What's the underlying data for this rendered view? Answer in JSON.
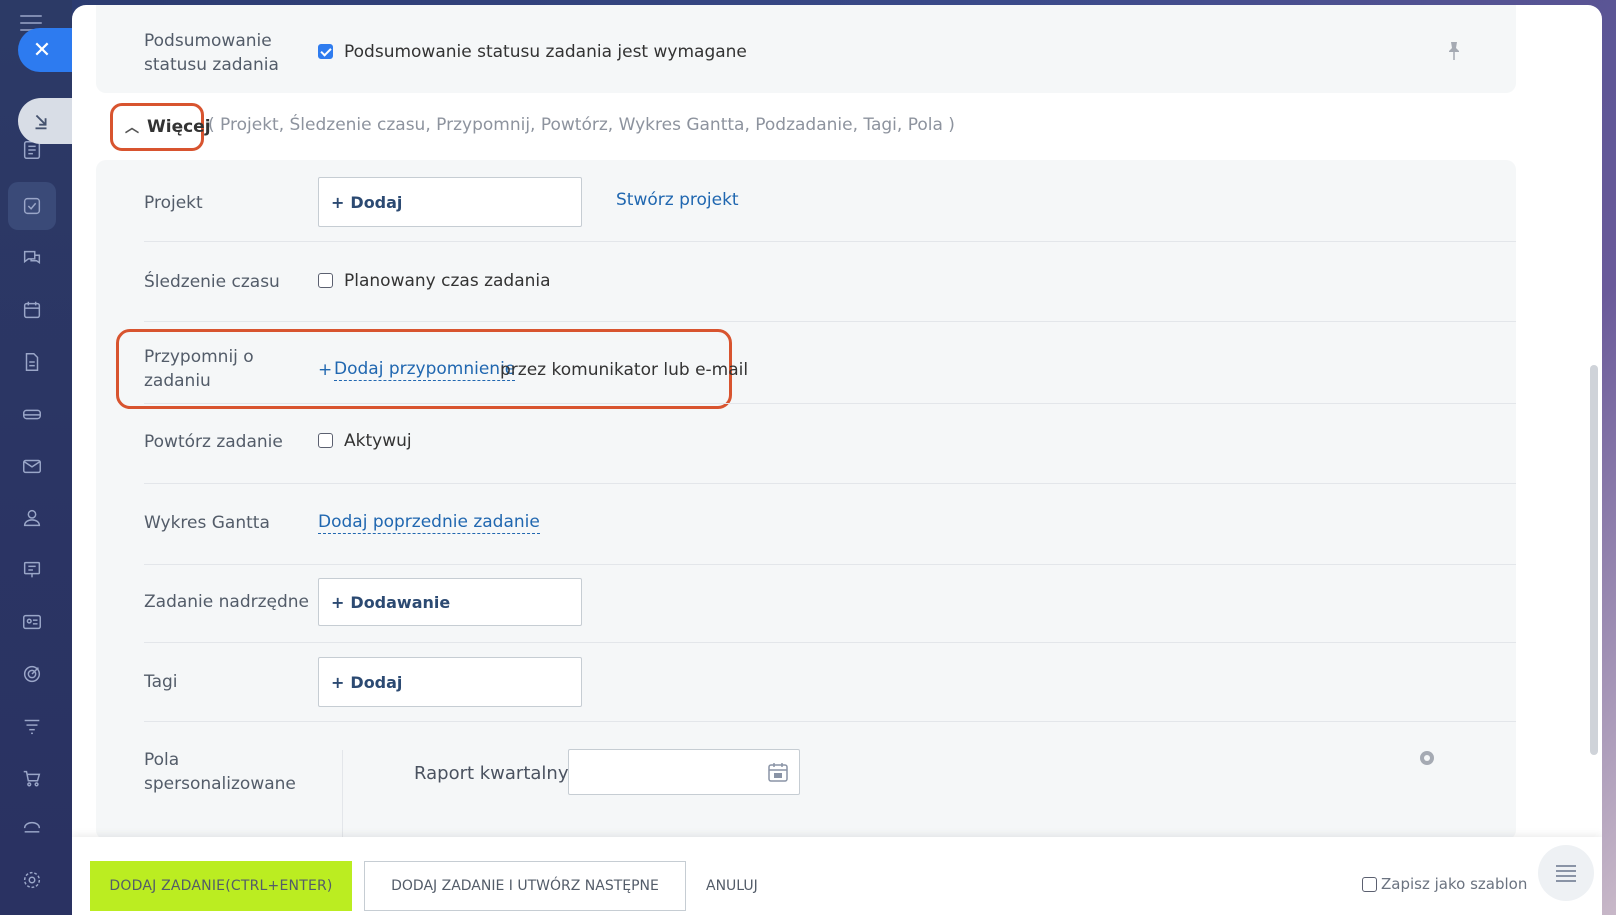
{
  "summary": {
    "label": "Podsumowanie statusu zadania",
    "checkbox_text": "Podsumowanie statusu zadania jest wymagane"
  },
  "more": {
    "button_label": "Więcej",
    "list_text": "( Projekt,  Śledzenie czasu,  Przypomnij,  Powtórz,  Wykres Gantta,  Podzadanie,  Tagi,  Pola )"
  },
  "fields": {
    "project": {
      "label": "Projekt",
      "button": "Dodaj",
      "link": "Stwórz projekt"
    },
    "time_tracking": {
      "label": "Śledzenie czasu",
      "checkbox_text": "Planowany czas zadania"
    },
    "reminder": {
      "label": "Przypomnij o zadaniu",
      "link": "Dodaj przypomnienie",
      "suffix": "przez komunikator lub e-mail"
    },
    "repeat": {
      "label": "Powtórz zadanie",
      "checkbox_text": "Aktywuj"
    },
    "gantt": {
      "label": "Wykres Gantta",
      "link": "Dodaj poprzednie zadanie"
    },
    "parent_task": {
      "label": "Zadanie nadrzędne",
      "button": "Dodawanie"
    },
    "tags": {
      "label": "Tagi",
      "button": "Dodaj"
    },
    "custom_fields": {
      "label": "Pola spersonalizowane",
      "field_label": "Raport kwartalny"
    }
  },
  "footer": {
    "primary_button": "DODAJ ZADANIE(CTRL+ENTER)",
    "secondary_button": "DODAJ ZADANIE I UTWÓRZ NASTĘPNE",
    "cancel_button": "ANULUJ",
    "save_template": "Zapisz jako szablon"
  },
  "colors": {
    "accent": "#2f7cef",
    "highlight": "#d8542f",
    "primary_button": "#bbed21"
  }
}
